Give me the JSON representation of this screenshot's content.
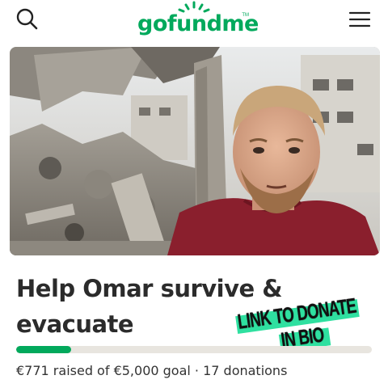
{
  "header": {
    "logo_text": "gofundme",
    "logo_tm": "TM",
    "search_icon": "search-icon",
    "menu_icon": "hamburger-menu-icon"
  },
  "campaign": {
    "title": "Help Omar survive & evacuate",
    "progress_fraction": 0.154,
    "stats": "€771 raised of €5,000 goal · 17 donations"
  },
  "sticker": {
    "line1": "LINK TO DONATE",
    "line2": "IN BIO",
    "highlight_color": "#2fe0a0"
  },
  "colors": {
    "brand": "#02a95c",
    "progress_track": "#e8e5df",
    "text": "#2b2b2b"
  }
}
